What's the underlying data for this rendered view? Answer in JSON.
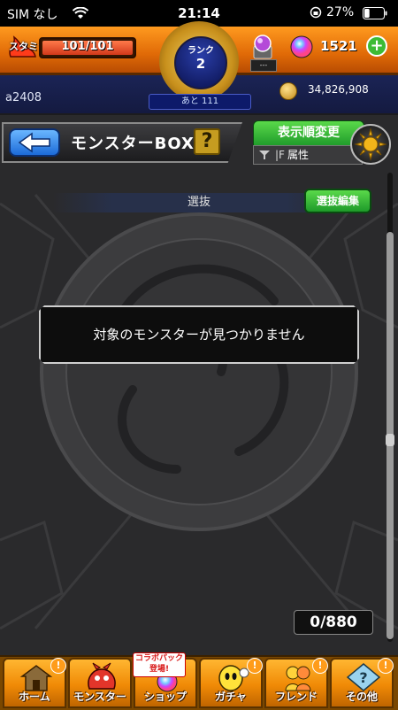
{
  "status_bar": {
    "carrier": "SIM なし",
    "time": "21:14",
    "battery_percent": "27%",
    "battery_level": 0.27
  },
  "header": {
    "stamina_label": "スタミナ",
    "stamina_text": "101/101",
    "stamina_level": 1.0,
    "rank_label": "ランク",
    "rank_value": "2",
    "rank_next_text": "あと 111",
    "orb_sub_text": "---",
    "gem_count": "1521",
    "plus_label": "+",
    "username": "a2408",
    "coin_count": "34,826,908"
  },
  "titlebar": {
    "title": "モンスターBOX",
    "help_label": "?",
    "sort_label": "表示順変更",
    "sort_glyph": "|F",
    "filter_label": "属性"
  },
  "main": {
    "select_label": "選抜",
    "edit_label": "選抜編集",
    "empty_message": "対象のモンスターが見つかりません",
    "box_count": "0/880"
  },
  "nav": {
    "items": [
      {
        "label": "ホーム",
        "icon": "home-icon"
      },
      {
        "label": "モンスター",
        "icon": "monster-icon"
      },
      {
        "label": "ショップ",
        "icon": "shop-icon"
      },
      {
        "label": "ガチャ",
        "icon": "gacha-icon"
      },
      {
        "label": "フレンド",
        "icon": "friend-icon"
      },
      {
        "label": "その他",
        "icon": "other-icon"
      }
    ],
    "collab_badge": "コラボパック登場!",
    "badge_mark": "!"
  },
  "colors": {
    "accent_orange": "#f08a06",
    "accent_green": "#1e9a2a",
    "header_blue": "#1b2456"
  }
}
